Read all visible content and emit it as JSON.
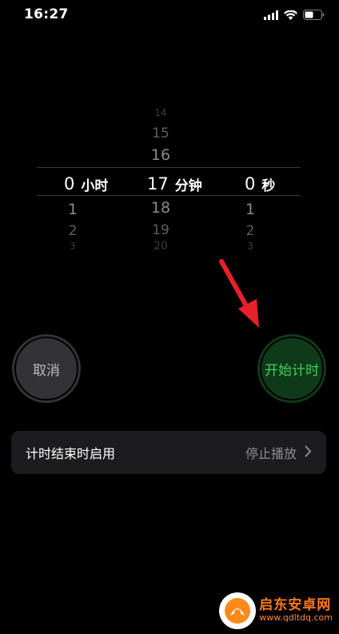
{
  "status_bar": {
    "time": "16:27",
    "icons": [
      "signal-icon",
      "wifi-icon",
      "battery-icon"
    ]
  },
  "picker": {
    "hours": {
      "above": [],
      "selected": "0",
      "unit": "小时",
      "below": [
        "1",
        "2",
        "3"
      ]
    },
    "minutes": {
      "above": [
        "14",
        "15",
        "16"
      ],
      "selected": "17",
      "unit": "分钟",
      "below": [
        "18",
        "19",
        "20"
      ]
    },
    "seconds": {
      "above": [],
      "selected": "0",
      "unit": "秒",
      "below": [
        "1",
        "2",
        "3"
      ]
    }
  },
  "buttons": {
    "cancel_label": "取消",
    "start_label": "开始计时"
  },
  "end_setting": {
    "label": "计时结束时启用",
    "value": "停止播放"
  },
  "watermark": {
    "title": "启东安卓网",
    "url": "www.qdltdq.com"
  },
  "colors": {
    "start_text": "#3fd15a",
    "start_bg": "#0f3a1a",
    "cancel_bg": "#333335",
    "arrow": "#e8202a"
  }
}
